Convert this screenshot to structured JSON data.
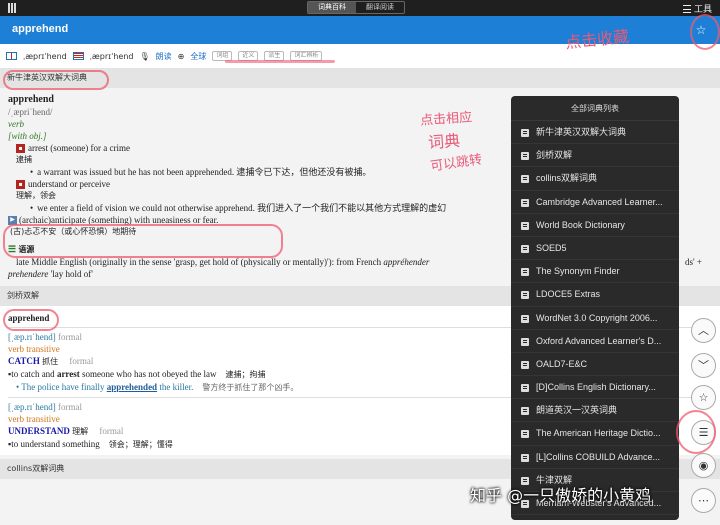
{
  "topbar": {
    "tab_active": "词典百科",
    "tab_other": "翻译阅读",
    "tools_label": "工具"
  },
  "header": {
    "word": "apprehend"
  },
  "pron": {
    "uk": "ˌæprɪˈhend",
    "us": "ˌæprɪˈhend",
    "link1": "朗读",
    "link2": "全球",
    "chips": [
      "词组",
      "近义",
      "派生",
      "词汇辨析"
    ]
  },
  "sections": {
    "oxford": {
      "head": "新牛津英汉双解大词典",
      "headword": "apprehend",
      "ipa": "/ˌæpriˈhend/",
      "pos": "verb",
      "with_obj": "[with obj.]",
      "sense1_en": "arrest (someone) for a crime",
      "sense1_zh": "逮捕",
      "ex1": "a warrant was issued but he has not been apprehended. 逮捕令已下达，但他还没有被捕。",
      "sense2_en": "understand or perceive",
      "sense2_zh": "理解，领会",
      "ex2": "we enter a field of vision we could not otherwise apprehend. 我们进入了一个我们不能以其他方式理解的虚幻",
      "sense3_en": "(archaic)anticipate (something) with uneasiness or fear.",
      "sense3_zh": "(古)忐忑不安（或心怀恐惧）地期待",
      "origin_head": "语源",
      "origin1": "late Middle English (originally in the sense 'grasp, get hold of (physically or mentally)'): from French",
      "origin_it": "appréhender",
      "origin_tail": "ds' +",
      "origin2_it": "prehendere",
      "origin2": "'lay hold of'"
    },
    "cambridge": {
      "head": "剑桥双解",
      "headword": "apprehend",
      "ipa1": "[ˌæp.rɪˈhend]",
      "formal1": "formal",
      "vt1": "verb transitive",
      "catch": "CATCH",
      "catch_zh": "抓住",
      "catch_formal": "formal",
      "def1_a": "to catch and",
      "def1_b": "arrest",
      "def1_c": "someone who has not obeyed the law",
      "def1_zh": "逮捕；拘捕",
      "ex_a": "The police have finally",
      "ex_b": "apprehended",
      "ex_c": "the killer.",
      "ex_zh": "警方终于抓住了那个凶手。",
      "ipa2": "[ˌæp.rɪˈhend]",
      "formal2": "formal",
      "vt2": "verb transitive",
      "understand": "UNDERSTAND",
      "understand_zh": "理解",
      "understand_formal": "formal",
      "def2": "to understand something",
      "def2_zh": "领会；理解；懂得"
    },
    "collins": {
      "head": "collins双解词典"
    }
  },
  "panel": {
    "title": "全部词典列表",
    "items": [
      "新牛津英汉双解大词典",
      "剑桥双解",
      "collins双解词典",
      "Cambridge Advanced Learner...",
      "World Book Dictionary",
      "SOED5",
      "The Synonym Finder",
      "LDOCE5 Extras",
      "WordNet 3.0 Copyright 2006...",
      "Oxford Advanced Learner's D...",
      "OALD7-E&C",
      "[D]Collins English Dictionary...",
      "朗道英汉一汉英词典",
      "The American Heritage Dictio...",
      "[L]Collins COBUILD Advance...",
      "牛津双解",
      "Merriam-Webster's Advanced..."
    ]
  },
  "annotations": {
    "top_right": "点击收藏",
    "side_1": "点击相应",
    "side_2": "词典",
    "side_3": "可以跳转"
  },
  "watermark": "知乎 @一只傲娇的小黄鸡"
}
